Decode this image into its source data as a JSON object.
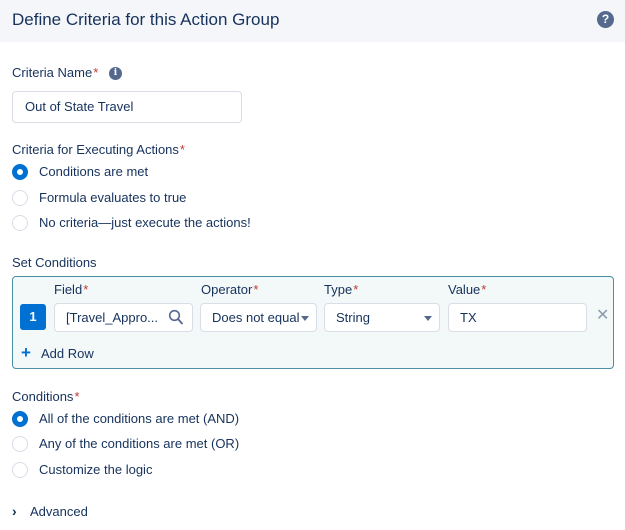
{
  "header": {
    "title": "Define Criteria for this Action Group",
    "help_icon": "question-circle-icon"
  },
  "criteria_name": {
    "label": "Criteria Name",
    "required_mark": "*",
    "value": "Out of State Travel"
  },
  "executing": {
    "label": "Criteria for Executing Actions",
    "required_mark": "*",
    "options": [
      {
        "label": "Conditions are met",
        "selected": true
      },
      {
        "label": "Formula evaluates to true",
        "selected": false
      },
      {
        "label": "No criteria—just execute the actions!",
        "selected": false
      }
    ]
  },
  "set_conditions": {
    "label": "Set Conditions",
    "columns": {
      "field": "Field",
      "operator": "Operator",
      "type": "Type",
      "value": "Value",
      "required_mark": "*"
    },
    "rows": [
      {
        "number": "1",
        "field": "[Travel_Appro...",
        "operator": "Does not equal",
        "type": "String",
        "value": "TX"
      }
    ],
    "add_row_label": "Add Row"
  },
  "conditions": {
    "label": "Conditions",
    "required_mark": "*",
    "options": [
      {
        "label": "All of the conditions are met (AND)",
        "selected": true
      },
      {
        "label": "Any of the conditions are met (OR)",
        "selected": false
      },
      {
        "label": "Customize the logic",
        "selected": false
      }
    ]
  },
  "advanced": {
    "label": "Advanced"
  },
  "colors": {
    "brand": "#0070d2",
    "text": "#16325c",
    "required": "#c23934",
    "border": "#d8dde6"
  }
}
